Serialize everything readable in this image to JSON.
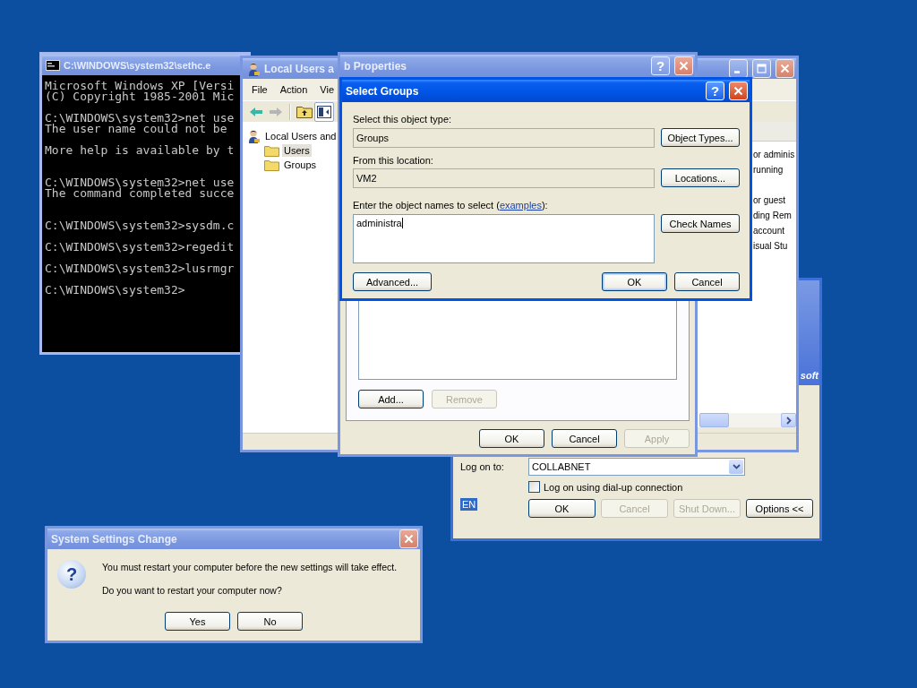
{
  "desktop": {
    "logon_window": {
      "active": false,
      "banner_text": "soft",
      "logon_label": "Log on to:",
      "domain_dropdown": {
        "value": "COLLABNET"
      },
      "dialup_checkbox": {
        "label": "Log on using dial-up connection",
        "checked": false
      },
      "language_indicator": "EN",
      "buttons": [
        {
          "label": "OK",
          "disabled": false
        },
        {
          "label": "Cancel",
          "disabled": true
        },
        {
          "label": "Shut Down...",
          "disabled": true
        },
        {
          "label": "Options <<",
          "disabled": false
        }
      ]
    },
    "console_window": {
      "active": false,
      "title": "C:\\WINDOWS\\system32\\sethc.e",
      "blocks": [
        {
          "kind": "single_gap",
          "lines": [
            "Microsoft Windows XP [Versi",
            "(C) Copyright 1985-2001 Mic"
          ]
        },
        {
          "kind": "single_gap",
          "lines": [
            "C:\\WINDOWS\\system32>net use",
            "The user name could not be"
          ]
        },
        {
          "kind": "double_gap",
          "lines": [
            "More help is available by t"
          ]
        },
        {
          "kind": "double_gap",
          "lines": [
            "C:\\WINDOWS\\system32>net use",
            "The command completed succe"
          ]
        },
        {
          "kind": "single_gap",
          "lines": [
            "C:\\WINDOWS\\system32>sysdm.c"
          ]
        },
        {
          "kind": "single_gap",
          "lines": [
            "C:\\WINDOWS\\system32>regedit"
          ]
        },
        {
          "kind": "single_gap",
          "lines": [
            "C:\\WINDOWS\\system32>lusrmgr"
          ]
        },
        {
          "kind": "single_gap",
          "lines": [
            "C:\\WINDOWS\\system32>"
          ]
        }
      ]
    },
    "local_users_window": {
      "active": false,
      "title": "Local Users a",
      "caption_buttons": [
        {
          "kind": "minimize"
        },
        {
          "kind": "maximize"
        },
        {
          "kind": "close"
        }
      ],
      "menu": [
        "File",
        "Action",
        "Vie"
      ],
      "toolbar": [
        {
          "kind": "back",
          "disabled": false,
          "pressed": false
        },
        {
          "kind": "forward",
          "disabled": true,
          "pressed": false
        },
        {
          "kind": "up",
          "disabled": false,
          "pressed": false
        },
        {
          "kind": "pane",
          "disabled": false,
          "pressed": true
        }
      ],
      "tree": [
        {
          "label": "Local Users and",
          "selected": false,
          "children": [
            {
              "label": "Users",
              "selected": true
            },
            {
              "label": "Groups",
              "selected": false
            }
          ]
        }
      ],
      "list_rows": [
        {
          "kind": "text",
          "text": "or adminis"
        },
        {
          "kind": "text",
          "text": "running"
        },
        {
          "kind": "blank"
        },
        {
          "kind": "text",
          "text": "or guest"
        },
        {
          "kind": "text",
          "text": "ding Rem"
        },
        {
          "kind": "text",
          "text": "account"
        },
        {
          "kind": "text",
          "text": "isual Stu"
        }
      ]
    },
    "properties_window": {
      "active": false,
      "title": "b Properties",
      "caption_buttons": [
        {
          "kind": "help",
          "glyph": "?"
        },
        {
          "kind": "close"
        }
      ],
      "panel_buttons": [
        {
          "label": "Add...",
          "disabled": false
        },
        {
          "label": "Remove",
          "disabled": true
        }
      ],
      "buttons": [
        {
          "label": "OK",
          "disabled": false
        },
        {
          "label": "Cancel",
          "disabled": false
        },
        {
          "label": "Apply",
          "disabled": true
        }
      ]
    },
    "select_groups_dialog": {
      "active": true,
      "title": "Select Groups",
      "caption_buttons": [
        {
          "kind": "help",
          "glyph": "?"
        },
        {
          "kind": "close"
        }
      ],
      "object_type_label": "Select this object type:",
      "object_type": "Groups",
      "object_types_button": "Object Types...",
      "location_label": "From this location:",
      "location": "VM2",
      "locations_button": "Locations...",
      "names_label": {
        "before": "Enter the object names to select (",
        "link": "examples",
        "after": "):"
      },
      "names_value": "administra",
      "check_names_button": "Check Names",
      "advanced_button": "Advanced...",
      "buttons": [
        {
          "label": "OK",
          "default": true
        },
        {
          "label": "Cancel",
          "default": false
        }
      ]
    },
    "restart_dialog": {
      "active": false,
      "title": "System Settings Change",
      "caption_buttons": [
        {
          "kind": "close"
        }
      ],
      "icon_glyph": "?",
      "message": "You must restart your computer before the new settings will take effect.",
      "question": "Do you want to restart your computer now?",
      "buttons": [
        {
          "label": "Yes"
        },
        {
          "label": "No"
        }
      ]
    }
  }
}
